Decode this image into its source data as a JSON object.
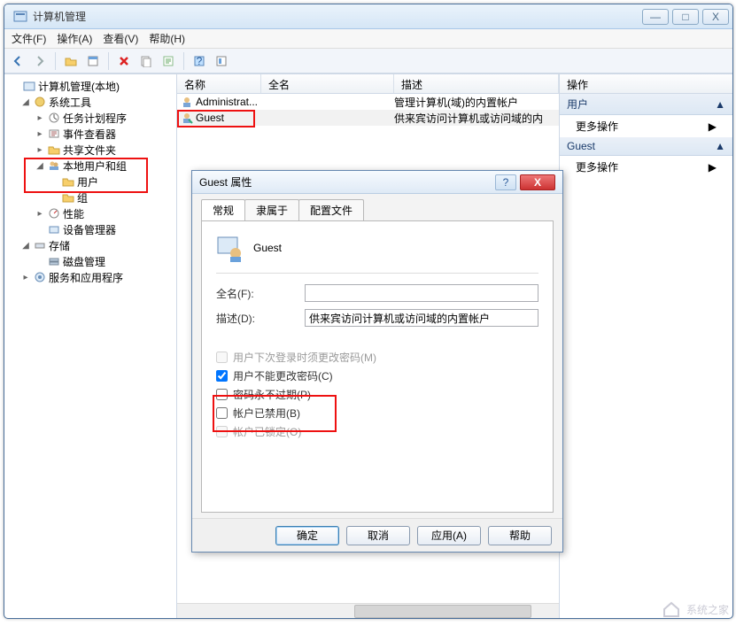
{
  "window": {
    "title": "计算机管理",
    "min": "—",
    "max": "□",
    "close": "X"
  },
  "menubar": {
    "file": "文件(F)",
    "action": "操作(A)",
    "view": "查看(V)",
    "help": "帮助(H)"
  },
  "tree": {
    "root": "计算机管理(本地)",
    "system_tools": "系统工具",
    "task_scheduler": "任务计划程序",
    "event_viewer": "事件查看器",
    "shared_folders": "共享文件夹",
    "local_users_groups": "本地用户和组",
    "users": "用户",
    "groups": "组",
    "performance": "性能",
    "device_manager": "设备管理器",
    "storage": "存储",
    "disk_mgmt": "磁盘管理",
    "services_apps": "服务和应用程序"
  },
  "list": {
    "col_name": "名称",
    "col_fullname": "全名",
    "col_desc": "描述",
    "rows": [
      {
        "name": "Administrat...",
        "fullname": "",
        "desc": "管理计算机(域)的内置帐户"
      },
      {
        "name": "Guest",
        "fullname": "",
        "desc": "供来宾访问计算机或访问域的内"
      }
    ]
  },
  "actions": {
    "header": "操作",
    "sec_users": "用户",
    "more1": "更多操作",
    "sec_guest": "Guest",
    "more2": "更多操作"
  },
  "dialog": {
    "title": "Guest 属性",
    "tab_general": "常规",
    "tab_memberof": "隶属于",
    "tab_profile": "配置文件",
    "username": "Guest",
    "fullname_label": "全名(F):",
    "fullname_value": "",
    "desc_label": "描述(D):",
    "desc_value": "供来宾访问计算机或访问域的内置帐户",
    "chk_mustchange": "用户下次登录时须更改密码(M)",
    "chk_cantchange": "用户不能更改密码(C)",
    "chk_neverexpire": "密码永不过期(P)",
    "chk_disabled": "帐户已禁用(B)",
    "chk_locked": "帐户已锁定(O)",
    "btn_ok": "确定",
    "btn_cancel": "取消",
    "btn_apply": "应用(A)",
    "btn_help": "帮助"
  },
  "watermark": "系统之家"
}
